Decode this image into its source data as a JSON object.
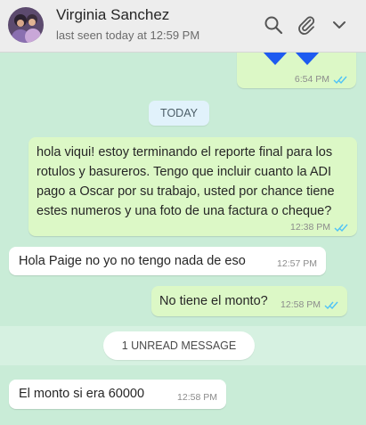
{
  "header": {
    "contact_name": "Virginia Sanchez",
    "status": "last seen today at 12:59 PM",
    "icons": [
      "search-icon",
      "paperclip-icon",
      "chevron-down-icon"
    ]
  },
  "chat": {
    "first_message": {
      "content": "blue-heart-emojis",
      "time": "6:54 PM",
      "status": "read"
    },
    "date_divider": "TODAY",
    "messages": [
      {
        "direction": "out",
        "text": "hola viqui! estoy terminando el reporte final para los rotulos y basureros. Tengo que incluir cuanto la ADI pago a Oscar por su trabajo, usted por chance tiene estes numeros y una foto de una factura o cheque?",
        "time": "12:38 PM",
        "status": "read"
      },
      {
        "direction": "in",
        "text": "Hola Paige no yo no tengo nada de eso",
        "time": "12:57 PM"
      },
      {
        "direction": "out",
        "text": "No tiene el monto?",
        "time": "12:58 PM",
        "status": "read"
      },
      {
        "direction": "in",
        "text": "El monto si era 60000",
        "time": "12:58 PM"
      }
    ],
    "unread_divider": "1 UNREAD MESSAGE"
  },
  "colors": {
    "chat_background": "#c9ecd7",
    "outgoing_bubble": "#dcf8c6",
    "incoming_bubble": "#ffffff",
    "read_ticks": "#4fc3f7",
    "heart": "#1e5bf0"
  }
}
